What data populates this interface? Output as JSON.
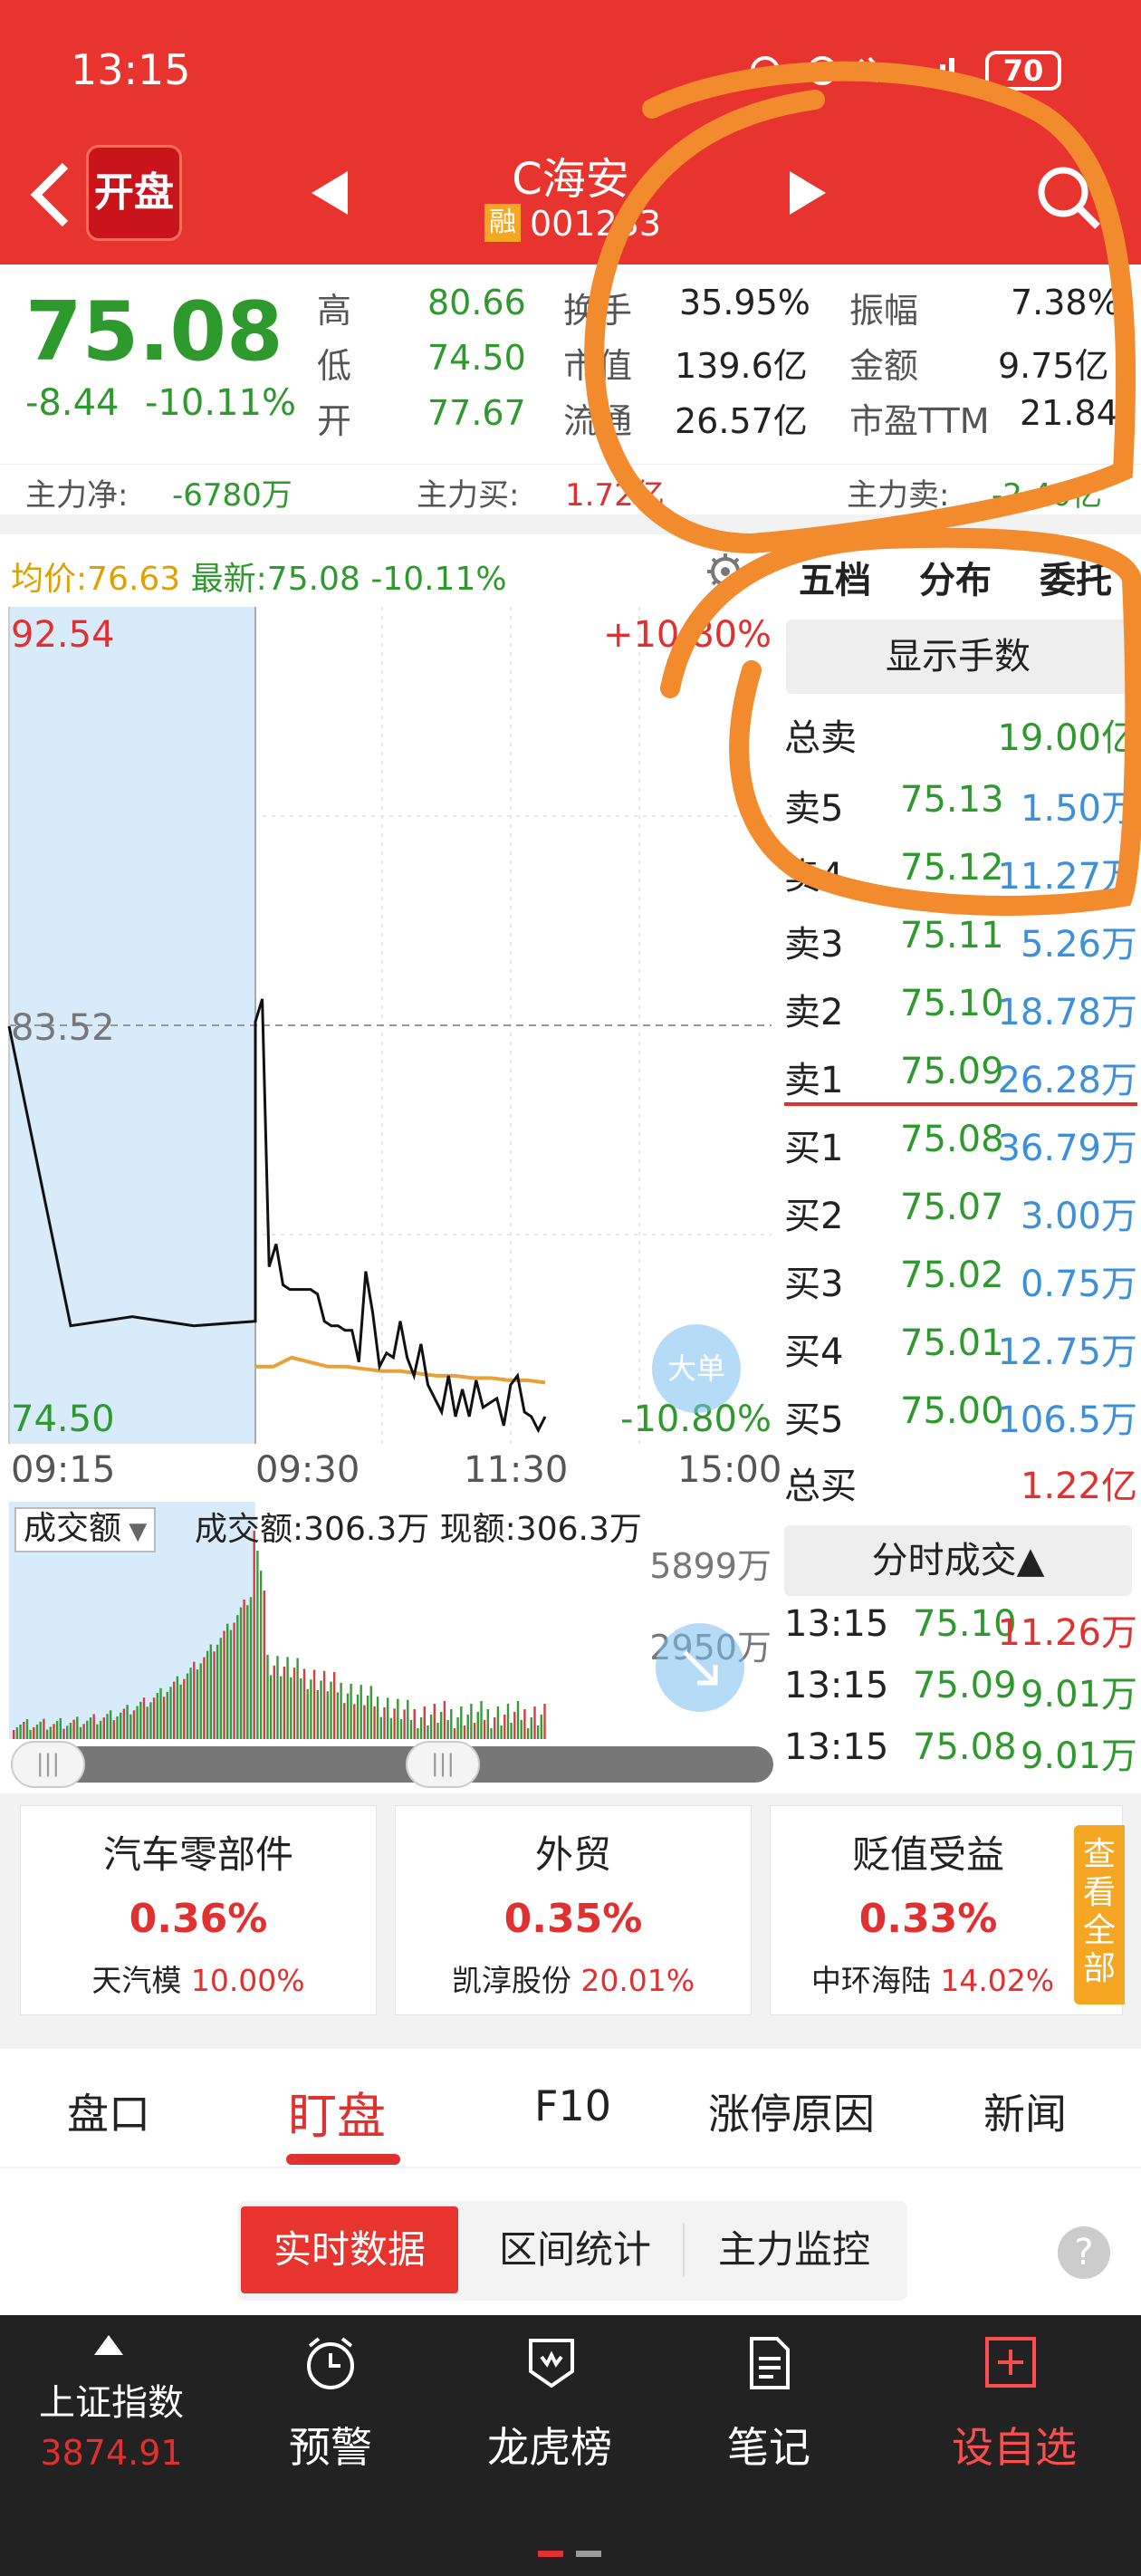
{
  "status": {
    "time": "13:15",
    "battery": "70"
  },
  "header": {
    "badge": "开盘",
    "stock_name": "C海安",
    "rong": "融",
    "code": "001233"
  },
  "quote": {
    "price": "75.08",
    "change": "-8.44",
    "change_pct": "-10.11%",
    "stats": [
      {
        "k1": "高",
        "v1": "80.66",
        "k2": "换手",
        "v2": "35.95%",
        "k3": "振幅",
        "v3": "7.38%"
      },
      {
        "k1": "低",
        "v1": "74.50",
        "k2": "市值",
        "v2": "139.6亿",
        "k3": "金额",
        "v3": "9.75亿"
      },
      {
        "k1": "开",
        "v1": "77.67",
        "k2": "流通",
        "v2": "26.57亿",
        "k3": "市盈TTM",
        "v3": "21.84"
      }
    ],
    "main_net_label": "主力净:",
    "main_net": "-6780万",
    "main_buy_label": "主力买:",
    "main_buy": "1.72亿",
    "main_sell_label": "主力卖:",
    "main_sell": "-2.40亿"
  },
  "chart_info": {
    "avg": "均价:76.63",
    "latest": "最新:75.08",
    "latest_pct": "-10.11%"
  },
  "chart_data": {
    "type": "line",
    "x": [
      "09:15",
      "09:30",
      "11:30",
      "15:00"
    ],
    "ylim": [
      74.5,
      92.54
    ],
    "ref": 83.52,
    "y_top": "92.54",
    "y_mid": "83.52",
    "y_bot": "74.50",
    "pct_top": "+10.80%",
    "pct_bot": "-10.80%",
    "price_series": {
      "name": "最新",
      "values": [
        83.5,
        76.9,
        77.1,
        76.9,
        77.0,
        83.6,
        84.1,
        78.2,
        78.7,
        77.8,
        77.7,
        77.7,
        77.7,
        77.7,
        77.6,
        77.0,
        76.9,
        76.9,
        76.8,
        76.8,
        76.1,
        78.1,
        77.2,
        76.0,
        76.3,
        76.2,
        77.0,
        76.2,
        75.8,
        76.5,
        75.6,
        75.3,
        75.0,
        75.8,
        74.9,
        75.5,
        74.9,
        75.7,
        75.1,
        75.2,
        75.3,
        74.7,
        75.6,
        75.8,
        75.0,
        74.9,
        74.6,
        74.9
      ]
    },
    "avg_series": {
      "name": "均价",
      "values": [
        76.0,
        76.0,
        76.2,
        76.1,
        76.0,
        76.0,
        75.95,
        75.9,
        75.9,
        75.85,
        75.8,
        75.8,
        75.75,
        75.75,
        75.7,
        75.7,
        75.65
      ]
    },
    "volume_label": "成交额",
    "vol_info": "成交额:306.3万",
    "vol_now": "现额:306.3万",
    "vol_top": "5899万",
    "vol_mid": "2950万"
  },
  "big_order": "大单",
  "book": {
    "tabs": [
      "五档",
      "分布",
      "委托"
    ],
    "show_btn": "显示手数",
    "total_sell_label": "总卖",
    "total_sell": "19.00亿",
    "sells": [
      {
        "l": "卖5",
        "p": "75.13",
        "v": "1.50万"
      },
      {
        "l": "卖4",
        "p": "75.12",
        "v": "11.27万"
      },
      {
        "l": "卖3",
        "p": "75.11",
        "v": "5.26万"
      },
      {
        "l": "卖2",
        "p": "75.10",
        "v": "18.78万"
      },
      {
        "l": "卖1",
        "p": "75.09",
        "v": "26.28万"
      }
    ],
    "buys": [
      {
        "l": "买1",
        "p": "75.08",
        "v": "36.79万"
      },
      {
        "l": "买2",
        "p": "75.07",
        "v": "3.00万"
      },
      {
        "l": "买3",
        "p": "75.02",
        "v": "0.75万"
      },
      {
        "l": "买4",
        "p": "75.01",
        "v": "12.75万"
      },
      {
        "l": "买5",
        "p": "75.00",
        "v": "106.5万"
      }
    ],
    "total_buy_label": "总买",
    "total_buy": "1.22亿",
    "ticks_btn": "分时成交▲",
    "ticks": [
      {
        "t": "13:15",
        "p": "75.10",
        "v": "11.26万"
      },
      {
        "t": "13:15",
        "p": "75.09",
        "v": "9.01万"
      },
      {
        "t": "13:15",
        "p": "75.08",
        "v": "9.01万"
      }
    ]
  },
  "sectors": [
    {
      "name": "汽车零部件",
      "pct": "0.36%",
      "lead": "天汽模",
      "lead_pct": "10.00%"
    },
    {
      "name": "外贸",
      "pct": "0.35%",
      "lead": "凯淳股份",
      "lead_pct": "20.01%"
    },
    {
      "name": "贬值受益",
      "pct": "0.33%",
      "lead": "中环海陆",
      "lead_pct": "14.02%"
    }
  ],
  "see_all": "查看全部",
  "tabs": [
    "盘口",
    "盯盘",
    "F10",
    "涨停原因",
    "新闻"
  ],
  "subtabs": [
    "实时数据",
    "区间统计",
    "主力监控"
  ],
  "help": "?",
  "bottom": {
    "index_name": "上证指数",
    "index_val": "3874.91",
    "items": [
      "预警",
      "龙虎榜",
      "笔记",
      "设自选"
    ]
  }
}
